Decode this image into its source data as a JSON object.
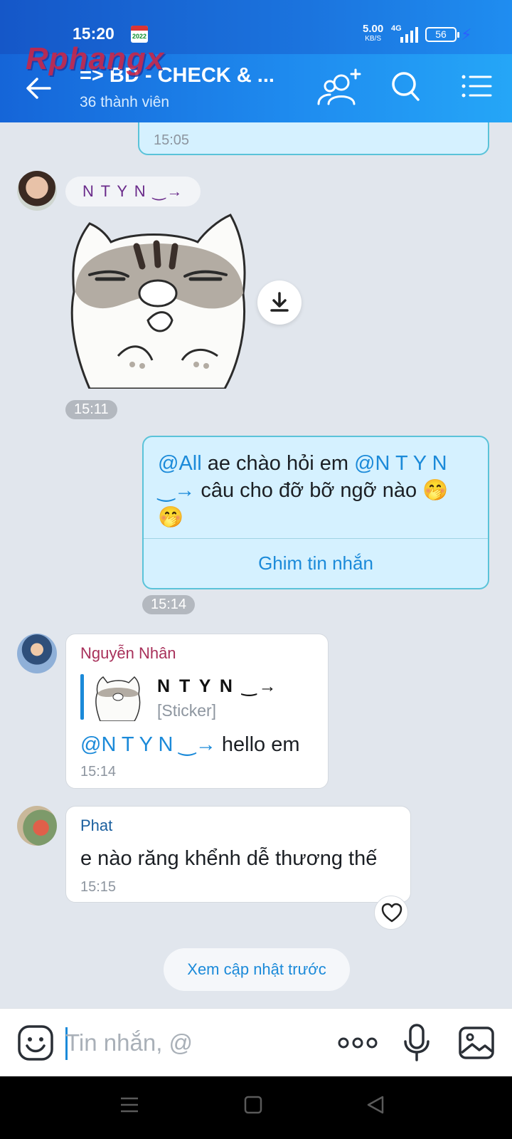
{
  "status_bar": {
    "time": "15:20",
    "calendar_badge": "2022",
    "net_speed": "5.00",
    "net_speed_unit": "KB/S",
    "network_type": "4G",
    "battery": "56"
  },
  "watermark": "Rphangx",
  "header": {
    "title": "=> BD - CHECK & ...",
    "subtitle": "36 thành viên",
    "icons": [
      "back-arrow-icon",
      "add-member-icon",
      "search-icon",
      "menu-list-icon"
    ]
  },
  "messages": {
    "prev_self_time": "15:05",
    "sticker_msg": {
      "sender": "N T Y N ‿→",
      "time": "15:11",
      "icons": [
        "cat-sticker",
        "download-icon"
      ]
    },
    "self_msg": {
      "mention_all": "@All",
      "text_1": " ae chào hỏi em ",
      "mention_user": "@N T Y N ‿→",
      "text_2": "  câu cho đỡ bỡ ngỡ nào 🤭",
      "emoji_line": "🤭",
      "pin_label": "Ghim tin nhắn",
      "time": "15:14"
    },
    "reply_msg": {
      "sender": "Nguyễn Nhân",
      "quote_name": "N T Y N ‿→",
      "quote_type": "[Sticker]",
      "mention": "@N T Y N ‿→",
      "text": " hello em",
      "time": "15:14"
    },
    "phat_msg": {
      "sender": "Phat",
      "text": "e nào răng khểnh dễ thương thế",
      "time": "15:15"
    },
    "see_more_label": "Xem cập nhật trước"
  },
  "composer": {
    "placeholder": "Tin nhắn, @",
    "value": "",
    "icons": [
      "emoji-icon",
      "more-dots-icon",
      "microphone-icon",
      "image-icon"
    ]
  },
  "colors": {
    "header_blue": "#1b7fe8",
    "accent": "#1b8ad9",
    "self_bubble": "#d5f1ff",
    "chat_bg": "#e1e6ed"
  }
}
